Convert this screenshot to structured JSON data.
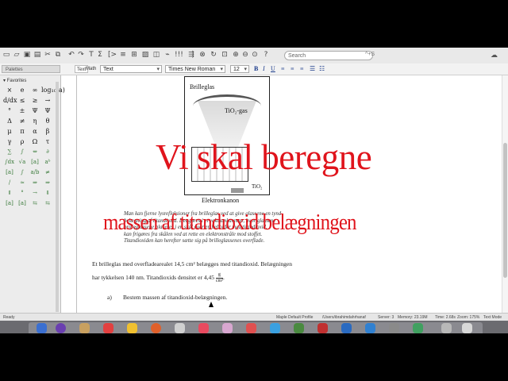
{
  "toolbar": {
    "search_placeholder": "Search",
    "search_shortcut": "^+S",
    "icons": [
      "new-document-icon",
      "open-icon",
      "save-icon",
      "print-icon",
      "cut-icon",
      "copy-icon",
      "paste-icon",
      "undo-icon",
      "redo-icon",
      "text-icon",
      "math-prompt-icon",
      "execution-group-icon",
      "section-icon",
      "table-icon",
      "image-icon",
      "execute-icon",
      "restart-icon",
      "stop-icon",
      "zoom-icon",
      "help-icon",
      "cloud-icon"
    ]
  },
  "format_bar": {
    "palettes_label": "Palettes",
    "text_mode": "Text",
    "math_mode": "Math",
    "style": "Text",
    "font": "Times New Roman",
    "size": "12",
    "bold": "B",
    "italic": "I",
    "underline": "U"
  },
  "sidebar": {
    "favorites_label": "Favorites",
    "symbols": [
      "×",
      "e",
      "∞",
      "log₁₀(a)",
      "d/dx",
      "≤",
      "≥",
      "→",
      "°",
      "±",
      "Ψ",
      "Ψ",
      "Δ",
      "≠",
      "η",
      "θ",
      "μ",
      "π",
      "α",
      "β",
      "γ",
      "ρ",
      "Ω",
      "τ",
      "∑",
      "∫",
      "⇔",
      "∂",
      "∫dx",
      "√a",
      "[a]",
      "aᵇ",
      "[a]",
      "∫",
      "a/b",
      "≠",
      "/",
      "≈",
      "⇒",
      "⇒",
      "⇑",
      "°",
      "→",
      "⇓",
      "[a]",
      "[a]",
      "⇆",
      "⇆"
    ]
  },
  "figure": {
    "label_top": "Brilleglas",
    "label_gas": "TiO₂-gas",
    "label_src": "TiO₂",
    "caption": "Elektronkanon"
  },
  "italic_paragraph": [
    "Man kan fjerne lysrefleksioner fra brilleglas ved at give glassene en tynd",
    "belægning af titandioxid. Det gøres i et vakuumkammer, hvor glassene",
    "brilleglassene placeres i en skål over en beholder med titandioxid.",
    "kan frigøres fra skålen ved at rette en elektronstråle mod stoffet.",
    "Titandioxiden kan herefter sætte sig på brilleglassenes overflade."
  ],
  "problem": {
    "line1": "Et brilleglas med overfladearealet 14,5 cm² belægges med titandioxid. Belægningen",
    "line2": "har tykkelsen 140 nm. Titandioxids densitet er  4,45",
    "density_num": "g",
    "density_den": "cm³",
    "task_label": "a)",
    "task": "Bestem massen af titandioxid-belægningen."
  },
  "handwriting": {
    "line1": "Vi skal beregne",
    "line2": "massen af titandioxid belægningen"
  },
  "status_bar": {
    "ready": "Ready",
    "profile": "Maple Default Profile",
    "path": "/Users/ibrahimdahrhanaf",
    "server": "Server: 3",
    "memory": "Memory: 23.19M",
    "time": "Time: 2.68s",
    "zoom": "Zoom: 175%",
    "mode": "Text Mode"
  },
  "colors": {
    "annotation": "#e0141c",
    "toolbar_bg": "#e9e9e9",
    "dock_bg": "#6b6b70"
  }
}
